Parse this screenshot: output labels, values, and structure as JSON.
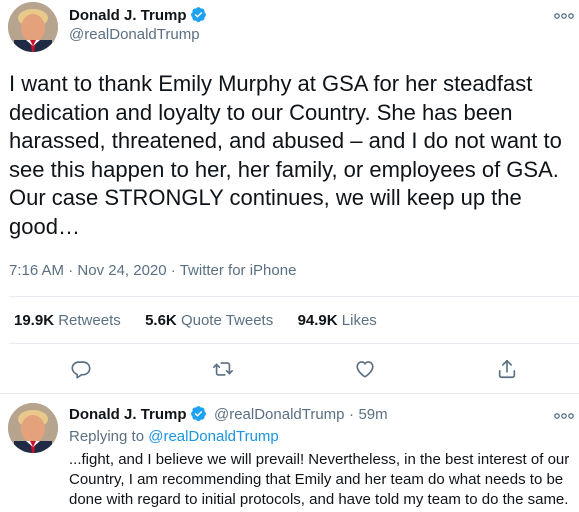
{
  "main_tweet": {
    "author_name": "Donald J. Trump",
    "author_handle": "@realDonaldTrump",
    "text": "I want to thank Emily Murphy at GSA for her steadfast dedication and loyalty to our Country. She has been harassed, threatened, and abused – and I do not want to see this happen to her, her family, or employees of GSA. Our case STRONGLY continues, we will keep up the good…",
    "time": "7:16 AM",
    "date": "Nov 24, 2020",
    "separator": "·",
    "source": "Twitter for iPhone",
    "stats": {
      "retweets_count": "19.9K",
      "retweets_label": "Retweets",
      "quotes_count": "5.6K",
      "quotes_label": "Quote Tweets",
      "likes_count": "94.9K",
      "likes_label": "Likes"
    },
    "actions": [
      "reply-icon",
      "retweet-icon",
      "like-icon",
      "share-icon"
    ]
  },
  "reply_tweet": {
    "author_name": "Donald J. Trump",
    "author_handle": "@realDonaldTrump",
    "separator": "·",
    "time_ago": "59m",
    "replying_prefix": "Replying to",
    "replying_to": "@realDonaldTrump",
    "text": "...fight, and I believe we will prevail! Nevertheless, in the best interest of our Country, I am recommending that Emily and her team do what needs to be done with regard to initial protocols, and have told my team to do the same."
  },
  "colors": {
    "verified_blue": "#1da1f2",
    "secondary_text": "#5b7083",
    "link_blue": "#1b95e0",
    "divider": "#e6ecf0"
  },
  "icons": [
    "verified-badge-icon",
    "more-options-icon",
    "avatar-photo"
  ]
}
